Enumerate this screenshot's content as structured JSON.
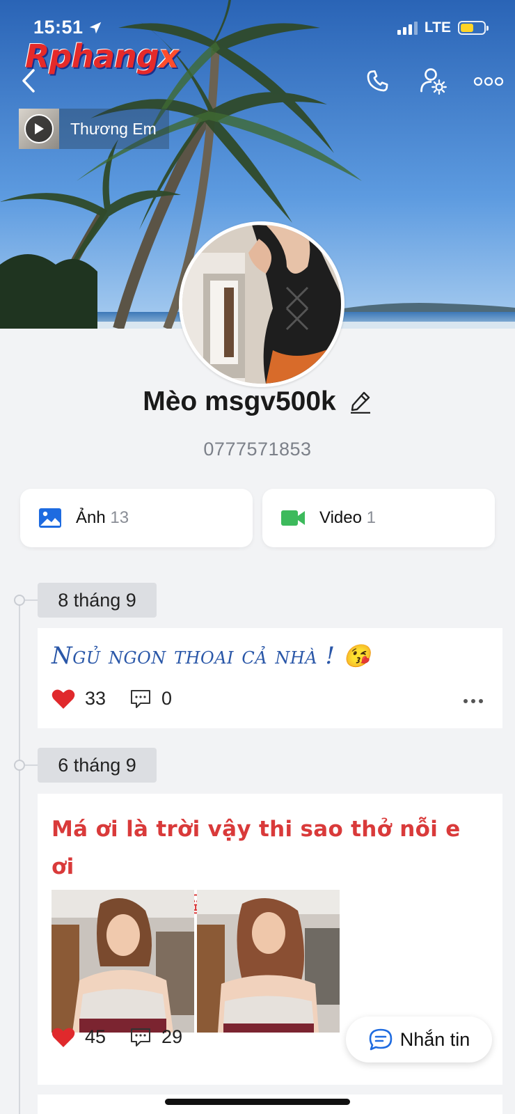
{
  "status_bar": {
    "time": "15:51",
    "network": "LTE",
    "battery_level": 0.55
  },
  "watermark": {
    "text_main": "Rphang",
    "text_x": "x"
  },
  "music": {
    "title": "Thương Em"
  },
  "profile": {
    "name": "Mèo msgv500k",
    "phone": "0777571853"
  },
  "media": {
    "photos": {
      "label": "Ảnh",
      "count": "13"
    },
    "videos": {
      "label": "Video",
      "count": "1"
    }
  },
  "timeline": [
    {
      "date": "8 tháng 9",
      "text": "Ngủ ngon thoai cả nhà !",
      "emoji": "😘",
      "likes": "33",
      "comments": "0"
    },
    {
      "date": "6 tháng 9",
      "text": "Má ơi là trời vậy thi sao thở nỗi e ơi",
      "emoji": "😂😂😂😂😂😂",
      "likes": "45",
      "comments": "29",
      "photo_count": 2
    }
  ],
  "message_button": {
    "label": "Nhắn tin"
  },
  "colors": {
    "accent_blue": "#2c6fc1",
    "like_red": "#e0292c",
    "photo_icon_blue": "#1e6be0",
    "video_icon_green": "#3dba5c"
  }
}
